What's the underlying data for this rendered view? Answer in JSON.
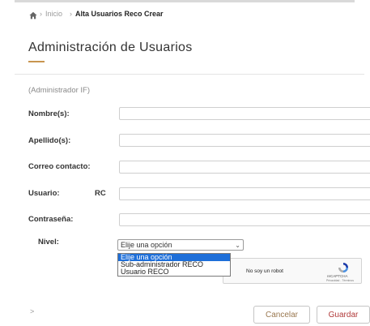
{
  "breadcrumb": {
    "separator": "›",
    "items": [
      "Inicio",
      "Alta Usuarios Reco Crear"
    ]
  },
  "page": {
    "title": "Administración de Usuarios",
    "subtitle": "(Administrador IF)"
  },
  "form": {
    "nombre_label": "Nombre(s):",
    "apellido_label": "Apellido(s):",
    "correo_label": "Correo contacto:",
    "usuario_label": "Usuario:",
    "usuario_prefix": "RC",
    "contrasena_label": "Contraseña:",
    "nivel_label": "Nivel:",
    "nivel_selected": "Elije una opción",
    "nivel_options": [
      "Elije una opción",
      "Sub-administrador RECO",
      "Usuario RECO"
    ]
  },
  "captcha": {
    "text": "No soy un robot",
    "brand": "reCAPTCHA",
    "legal": "Privacidad - Términos"
  },
  "footer": {
    "arrow": ">",
    "cancel_label": "Cancelar",
    "save_label": "Guardar"
  },
  "colors": {
    "accent": "#c8954f",
    "select_highlight": "#1e6fd9",
    "save_text": "#b13a3a"
  }
}
